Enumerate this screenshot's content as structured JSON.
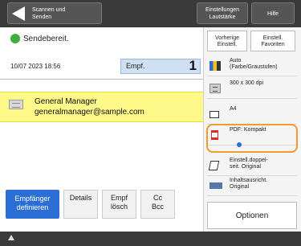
{
  "topbar": {
    "back_label": "Scannen und\nSenden",
    "settings_label": "Einstellungen\nLautstärke",
    "help_label": "Hilfe"
  },
  "status": {
    "text": "Sendebereit.",
    "color": "#3fae3f"
  },
  "date_time": "10/07 2023 18:56",
  "recipients": {
    "label": "Empf.",
    "count": "1",
    "items": [
      {
        "name": "General Manager",
        "email": "generalmanager@sample.com"
      }
    ]
  },
  "buttons": {
    "destinations": "Empfänger\ndefinieren",
    "details": "Details",
    "delete": "Empf\nlösch",
    "ccbcc": "Cc\nBcc"
  },
  "right_panel": {
    "prev_settings": "Vorherige\nEinstell.",
    "favorites": "Einstell.\nFavoriten",
    "settings": {
      "color": "Auto\n(Farbe/Graustufen)",
      "resolution": "300 x 300 dpi",
      "size": "A4",
      "format": "PDF: Kompakt",
      "duplex": "Einstell.doppel-\nseit. Original",
      "orientation": "Inhaltsausricht.\nOriginal"
    },
    "options": "Optionen"
  },
  "colors": {
    "accent_blue": "#2b6fd6",
    "highlight_yellow": "#fff98a",
    "highlight_orange": "#f29a2e"
  }
}
